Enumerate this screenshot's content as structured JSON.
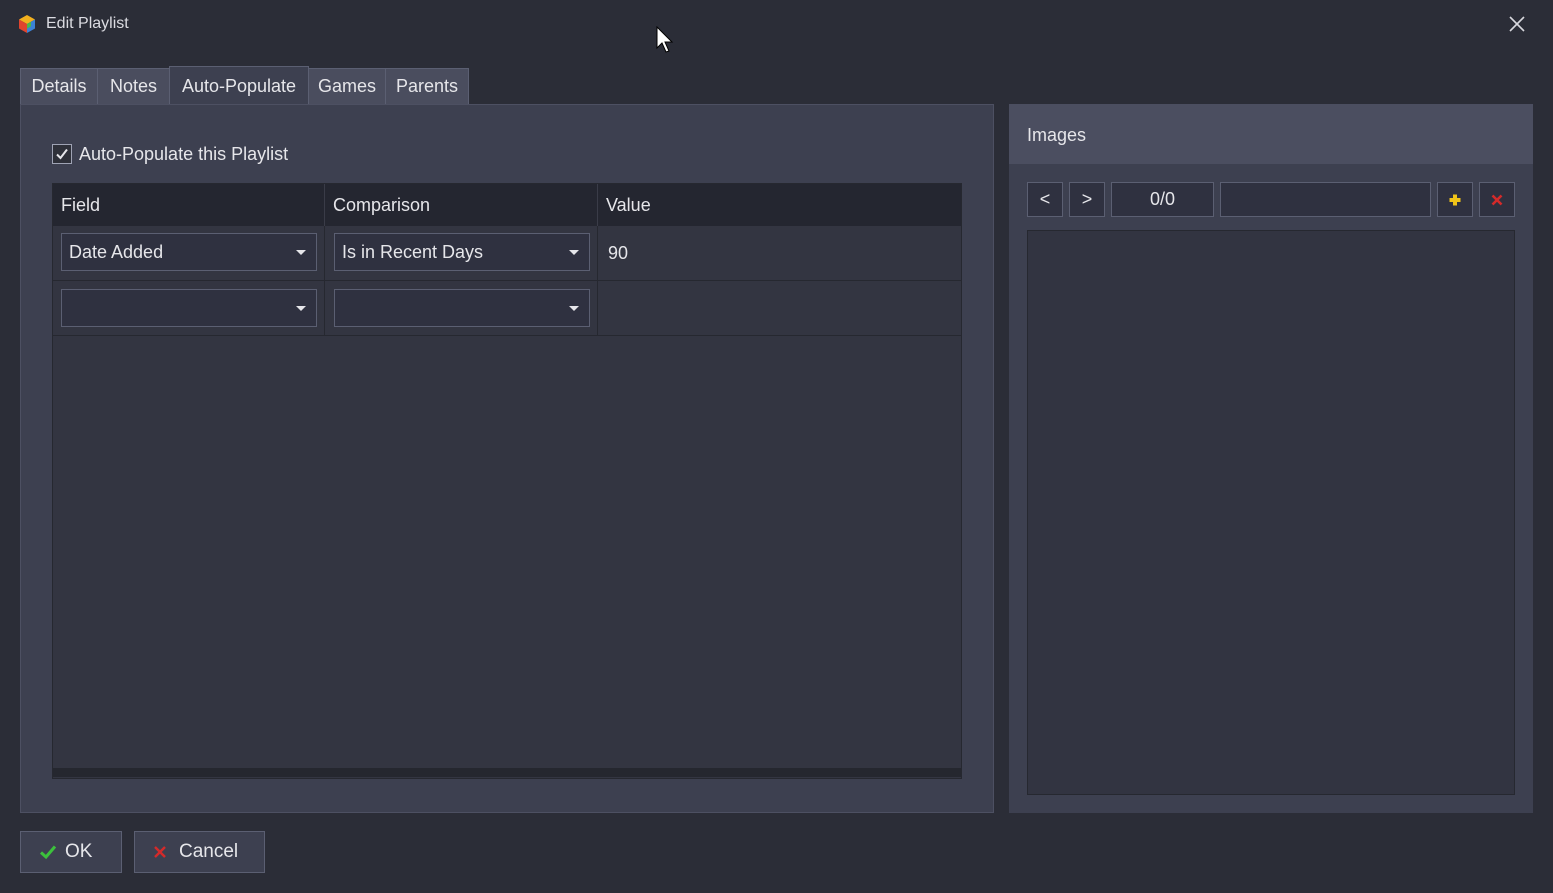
{
  "window": {
    "title": "Edit Playlist",
    "icons": {
      "app": "app-logo-icon",
      "close": "close-icon"
    }
  },
  "tabs": [
    {
      "label": "Details",
      "active": false
    },
    {
      "label": "Notes",
      "active": false
    },
    {
      "label": "Auto-Populate",
      "active": true
    },
    {
      "label": "Games",
      "active": false
    },
    {
      "label": "Parents",
      "active": false
    }
  ],
  "auto_populate": {
    "checkbox_label": "Auto-Populate this Playlist",
    "checked": true,
    "columns": [
      "Field",
      "Comparison",
      "Value"
    ],
    "rows": [
      {
        "field": "Date Added",
        "comparison": "Is in Recent Days",
        "value": "90"
      },
      {
        "field": "",
        "comparison": "",
        "value": ""
      }
    ]
  },
  "images": {
    "title": "Images",
    "prev_label": "<",
    "next_label": ">",
    "counter": "0/0",
    "path": "",
    "icons": {
      "add": "add-image-icon",
      "delete": "delete-image-icon"
    }
  },
  "footer": {
    "ok_label": "OK",
    "cancel_label": "Cancel",
    "icons": {
      "ok": "checkmark-icon",
      "cancel": "x-mark-icon"
    }
  },
  "colors": {
    "background": "#2b2d37",
    "panel": "#3d4050",
    "tab": "#4a4d5e",
    "ok_green": "#3cc13c",
    "cancel_red": "#d42a2a",
    "add_yellow": "#f0c419"
  }
}
